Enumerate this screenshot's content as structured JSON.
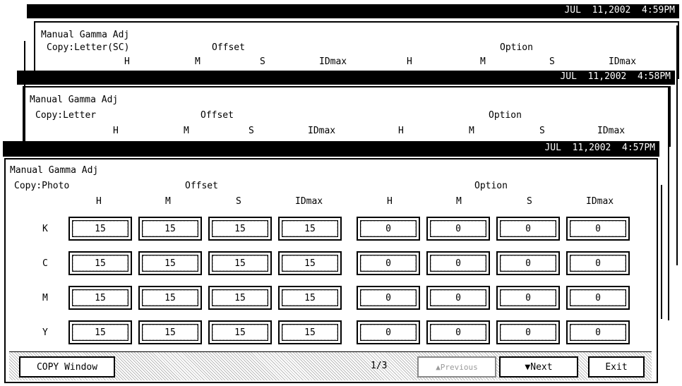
{
  "windows": [
    {
      "clock": "JUL  11,2002  4:59PM",
      "title": "Manual Gamma Adj",
      "mode": "Copy:Letter(SC)",
      "offset_label": "Offset",
      "option_label": "Option",
      "columns": [
        "H",
        "M",
        "S",
        "IDmax",
        "H",
        "M",
        "S",
        "IDmax"
      ]
    },
    {
      "clock": "JUL  11,2002  4:58PM",
      "title": "Manual Gamma Adj",
      "mode": "Copy:Letter",
      "offset_label": "Offset",
      "option_label": "Option",
      "columns": [
        "H",
        "M",
        "S",
        "IDmax",
        "H",
        "M",
        "S",
        "IDmax"
      ]
    },
    {
      "clock": "JUL  11,2002  4:57PM",
      "title": "Manual Gamma Adj",
      "mode": "Copy:Photo",
      "offset_label": "Offset",
      "option_label": "Option",
      "columns": [
        "H",
        "M",
        "S",
        "IDmax",
        "H",
        "M",
        "S",
        "IDmax"
      ],
      "rows": [
        {
          "label": "K",
          "values": [
            "15",
            "15",
            "15",
            "15",
            "0",
            "0",
            "0",
            "0"
          ]
        },
        {
          "label": "C",
          "values": [
            "15",
            "15",
            "15",
            "15",
            "0",
            "0",
            "0",
            "0"
          ]
        },
        {
          "label": "M",
          "values": [
            "15",
            "15",
            "15",
            "15",
            "0",
            "0",
            "0",
            "0"
          ]
        },
        {
          "label": "Y",
          "values": [
            "15",
            "15",
            "15",
            "15",
            "0",
            "0",
            "0",
            "0"
          ]
        }
      ],
      "footer": {
        "copy_window": "COPY Window",
        "page": "1/3",
        "previous": "▲Previous",
        "next": "▼Next",
        "exit": "Exit"
      }
    }
  ]
}
